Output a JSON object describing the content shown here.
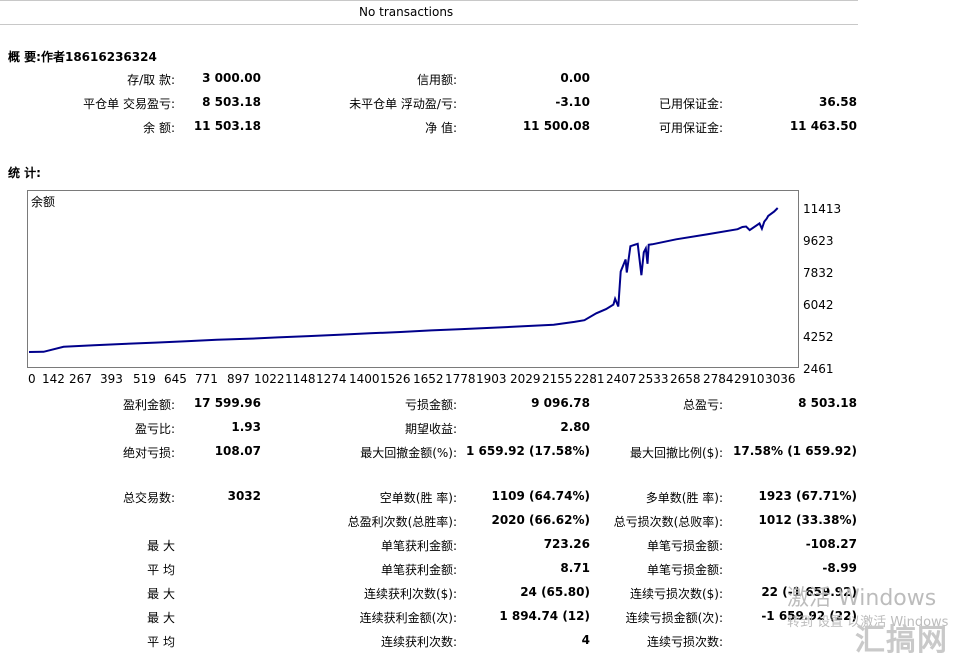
{
  "header": {
    "no_transactions": "No transactions"
  },
  "summary": {
    "title": "概 要:作者18616236324",
    "rows": [
      {
        "l1": "存/取 款:",
        "v1": "3 000.00",
        "l2": "信用额:",
        "v2": "0.00",
        "l3": "",
        "v3": ""
      },
      {
        "l1": "平仓单 交易盈亏:",
        "v1": "8 503.18",
        "l2": "未平仓单 浮动盈/亏:",
        "v2": "-3.10",
        "l3": "已用保证金:",
        "v3": "36.58"
      },
      {
        "l1": "余 额:",
        "v1": "11 503.18",
        "l2": "净 值:",
        "v2": "11 500.08",
        "l3": "可用保证金:",
        "v3": "11 463.50"
      }
    ]
  },
  "stats": {
    "title": "统 计:",
    "rows": [
      {
        "l1": "盈利金额:",
        "v1": "17 599.96",
        "l2": "亏损金额:",
        "v2": "9 096.78",
        "l3": "总盈亏:",
        "v3": "8 503.18"
      },
      {
        "l1": "盈亏比:",
        "v1": "1.93",
        "l2": "期望收益:",
        "v2": "2.80",
        "l3": "",
        "v3": ""
      },
      {
        "l1": "绝对亏损:",
        "v1": "108.07",
        "l2": "最大回撤金额(%):",
        "v2": "1 659.92 (17.58%)",
        "l3": "最大回撤比例($):",
        "v3": "17.58% (1 659.92)"
      },
      {
        "l1": "总交易数:",
        "v1": "3032",
        "l2": "空单数(胜 率):",
        "v2": "1109 (64.74%)",
        "l3": "多单数(胜 率):",
        "v3": "1923 (67.71%)"
      },
      {
        "l1": "",
        "v1": "",
        "l2": "总盈利次数(总胜率):",
        "v2": "2020 (66.62%)",
        "l3": "总亏损次数(总败率):",
        "v3": "1012 (33.38%)"
      },
      {
        "l1": "最 大",
        "v1": "",
        "l2": "单笔获利金额:",
        "v2": "723.26",
        "l3": "单笔亏损金额:",
        "v3": "-108.27"
      },
      {
        "l1": "平 均",
        "v1": "",
        "l2": "单笔获利金额:",
        "v2": "8.71",
        "l3": "单笔亏损金额:",
        "v3": "-8.99"
      },
      {
        "l1": "最 大",
        "v1": "",
        "l2": "连续获利次数($):",
        "v2": "24 (65.80)",
        "l3": "连续亏损次数($):",
        "v3": "22 (-1 659.92)"
      },
      {
        "l1": "最 大",
        "v1": "",
        "l2": "连续获利金额(次):",
        "v2": "1 894.74 (12)",
        "l3": "连续亏损金额(次):",
        "v3": "-1 659.92 (22)"
      },
      {
        "l1": "平 均",
        "v1": "",
        "l2": "连续获利次数:",
        "v2": "4",
        "l3": "连续亏损次数:",
        "v3": ""
      }
    ]
  },
  "chart_data": {
    "type": "line",
    "title": "余额",
    "color": "#00008b",
    "x_ticks": [
      "0",
      "142",
      "267",
      "393",
      "519",
      "645",
      "771",
      "897",
      "1022",
      "1148",
      "1274",
      "1400",
      "1526",
      "1652",
      "1778",
      "1903",
      "2029",
      "2155",
      "2281",
      "2407",
      "2533",
      "2658",
      "2784",
      "2910",
      "3036"
    ],
    "y_ticks": [
      "11413",
      "9623",
      "7832",
      "6042",
      "4252",
      "2461"
    ],
    "xlim": [
      0,
      3150
    ],
    "ylim": [
      2461,
      11413
    ],
    "x": [
      0,
      60,
      142,
      267,
      393,
      519,
      645,
      771,
      897,
      1022,
      1148,
      1274,
      1400,
      1526,
      1652,
      1778,
      1903,
      2029,
      2155,
      2240,
      2281,
      2330,
      2370,
      2400,
      2407,
      2420,
      2430,
      2450,
      2455,
      2470,
      2500,
      2515,
      2525,
      2533,
      2540,
      2545,
      2560,
      2658,
      2784,
      2910,
      2930,
      2945,
      2960,
      3000,
      3010,
      3020,
      3030,
      3036,
      3060,
      3075
    ],
    "y": [
      2990,
      3000,
      3290,
      3380,
      3460,
      3540,
      3620,
      3700,
      3760,
      3840,
      3920,
      4000,
      4080,
      4160,
      4250,
      4330,
      4410,
      4490,
      4580,
      4750,
      4850,
      5250,
      5500,
      5760,
      6100,
      5650,
      7700,
      8400,
      7640,
      9180,
      9320,
      7480,
      8820,
      9050,
      8150,
      9260,
      9290,
      9580,
      9870,
      10170,
      10300,
      10330,
      10120,
      10510,
      10200,
      10620,
      10800,
      10950,
      11200,
      11413
    ]
  },
  "watermark": {
    "line1": "激活 Windows",
    "line2": "转到 设置 以激活 Windows",
    "logo": "汇搞网"
  }
}
